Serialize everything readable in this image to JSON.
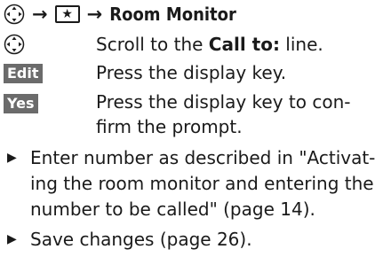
{
  "header": {
    "arrow_1": "→",
    "star_symbol": "★",
    "arrow_2": "→",
    "menu_label": "Room Monitor"
  },
  "steps": [
    {
      "key_icon": "nav-control-icon",
      "text_before": "Scroll to the ",
      "highlight": "Call to:",
      "text_after": " line."
    },
    {
      "key_label": "Edit",
      "text": "Press the display key."
    },
    {
      "key_label": "Yes",
      "text_line1": "Press the display key to con-",
      "text_line2": "firm the prompt."
    }
  ],
  "bullets": [
    {
      "lines": [
        "Enter number as described in \"Activat-",
        "ing the room monitor and entering the",
        "number to be called\" (page 14)."
      ]
    },
    {
      "lines": [
        "Save changes (page 26)."
      ]
    }
  ],
  "colors": {
    "key_label_bg": "#6b6b6b",
    "text": "#1a1a1a"
  }
}
